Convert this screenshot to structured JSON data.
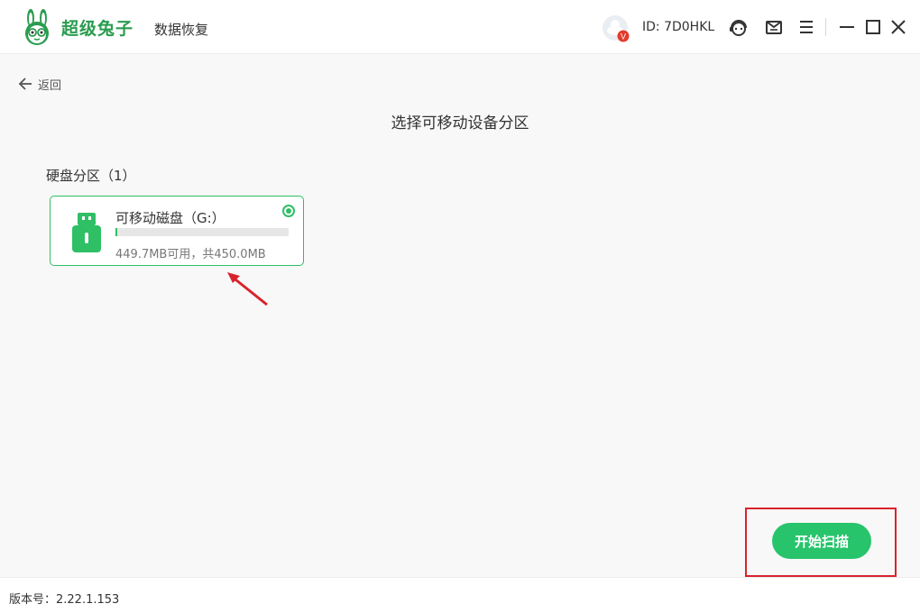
{
  "app": {
    "brand_name": "超级兔子",
    "brand_sub": "数据恢复",
    "user_id": "ID: 7D0HKL",
    "vip_badge": "V",
    "icons": [
      "rabbit-logo",
      "customer-service-icon",
      "message-icon",
      "menu-icon",
      "minimize-icon",
      "maximize-icon",
      "close-icon"
    ],
    "brand_color": "#2a9c4f"
  },
  "nav": {
    "back_label": "返回"
  },
  "main": {
    "title": "选择可移动设备分区",
    "section_label": "硬盘分区（1）",
    "drives": [
      {
        "name": "可移动磁盘（G:）",
        "size_text": "449.7MB可用，共450.0MB",
        "used_fraction": 0.0007,
        "selected": true,
        "icon": "usb-drive-icon"
      }
    ],
    "start_button": "开始扫描",
    "accent_color": "#27c46b"
  },
  "footer": {
    "version": "版本号：2.22.1.153"
  }
}
